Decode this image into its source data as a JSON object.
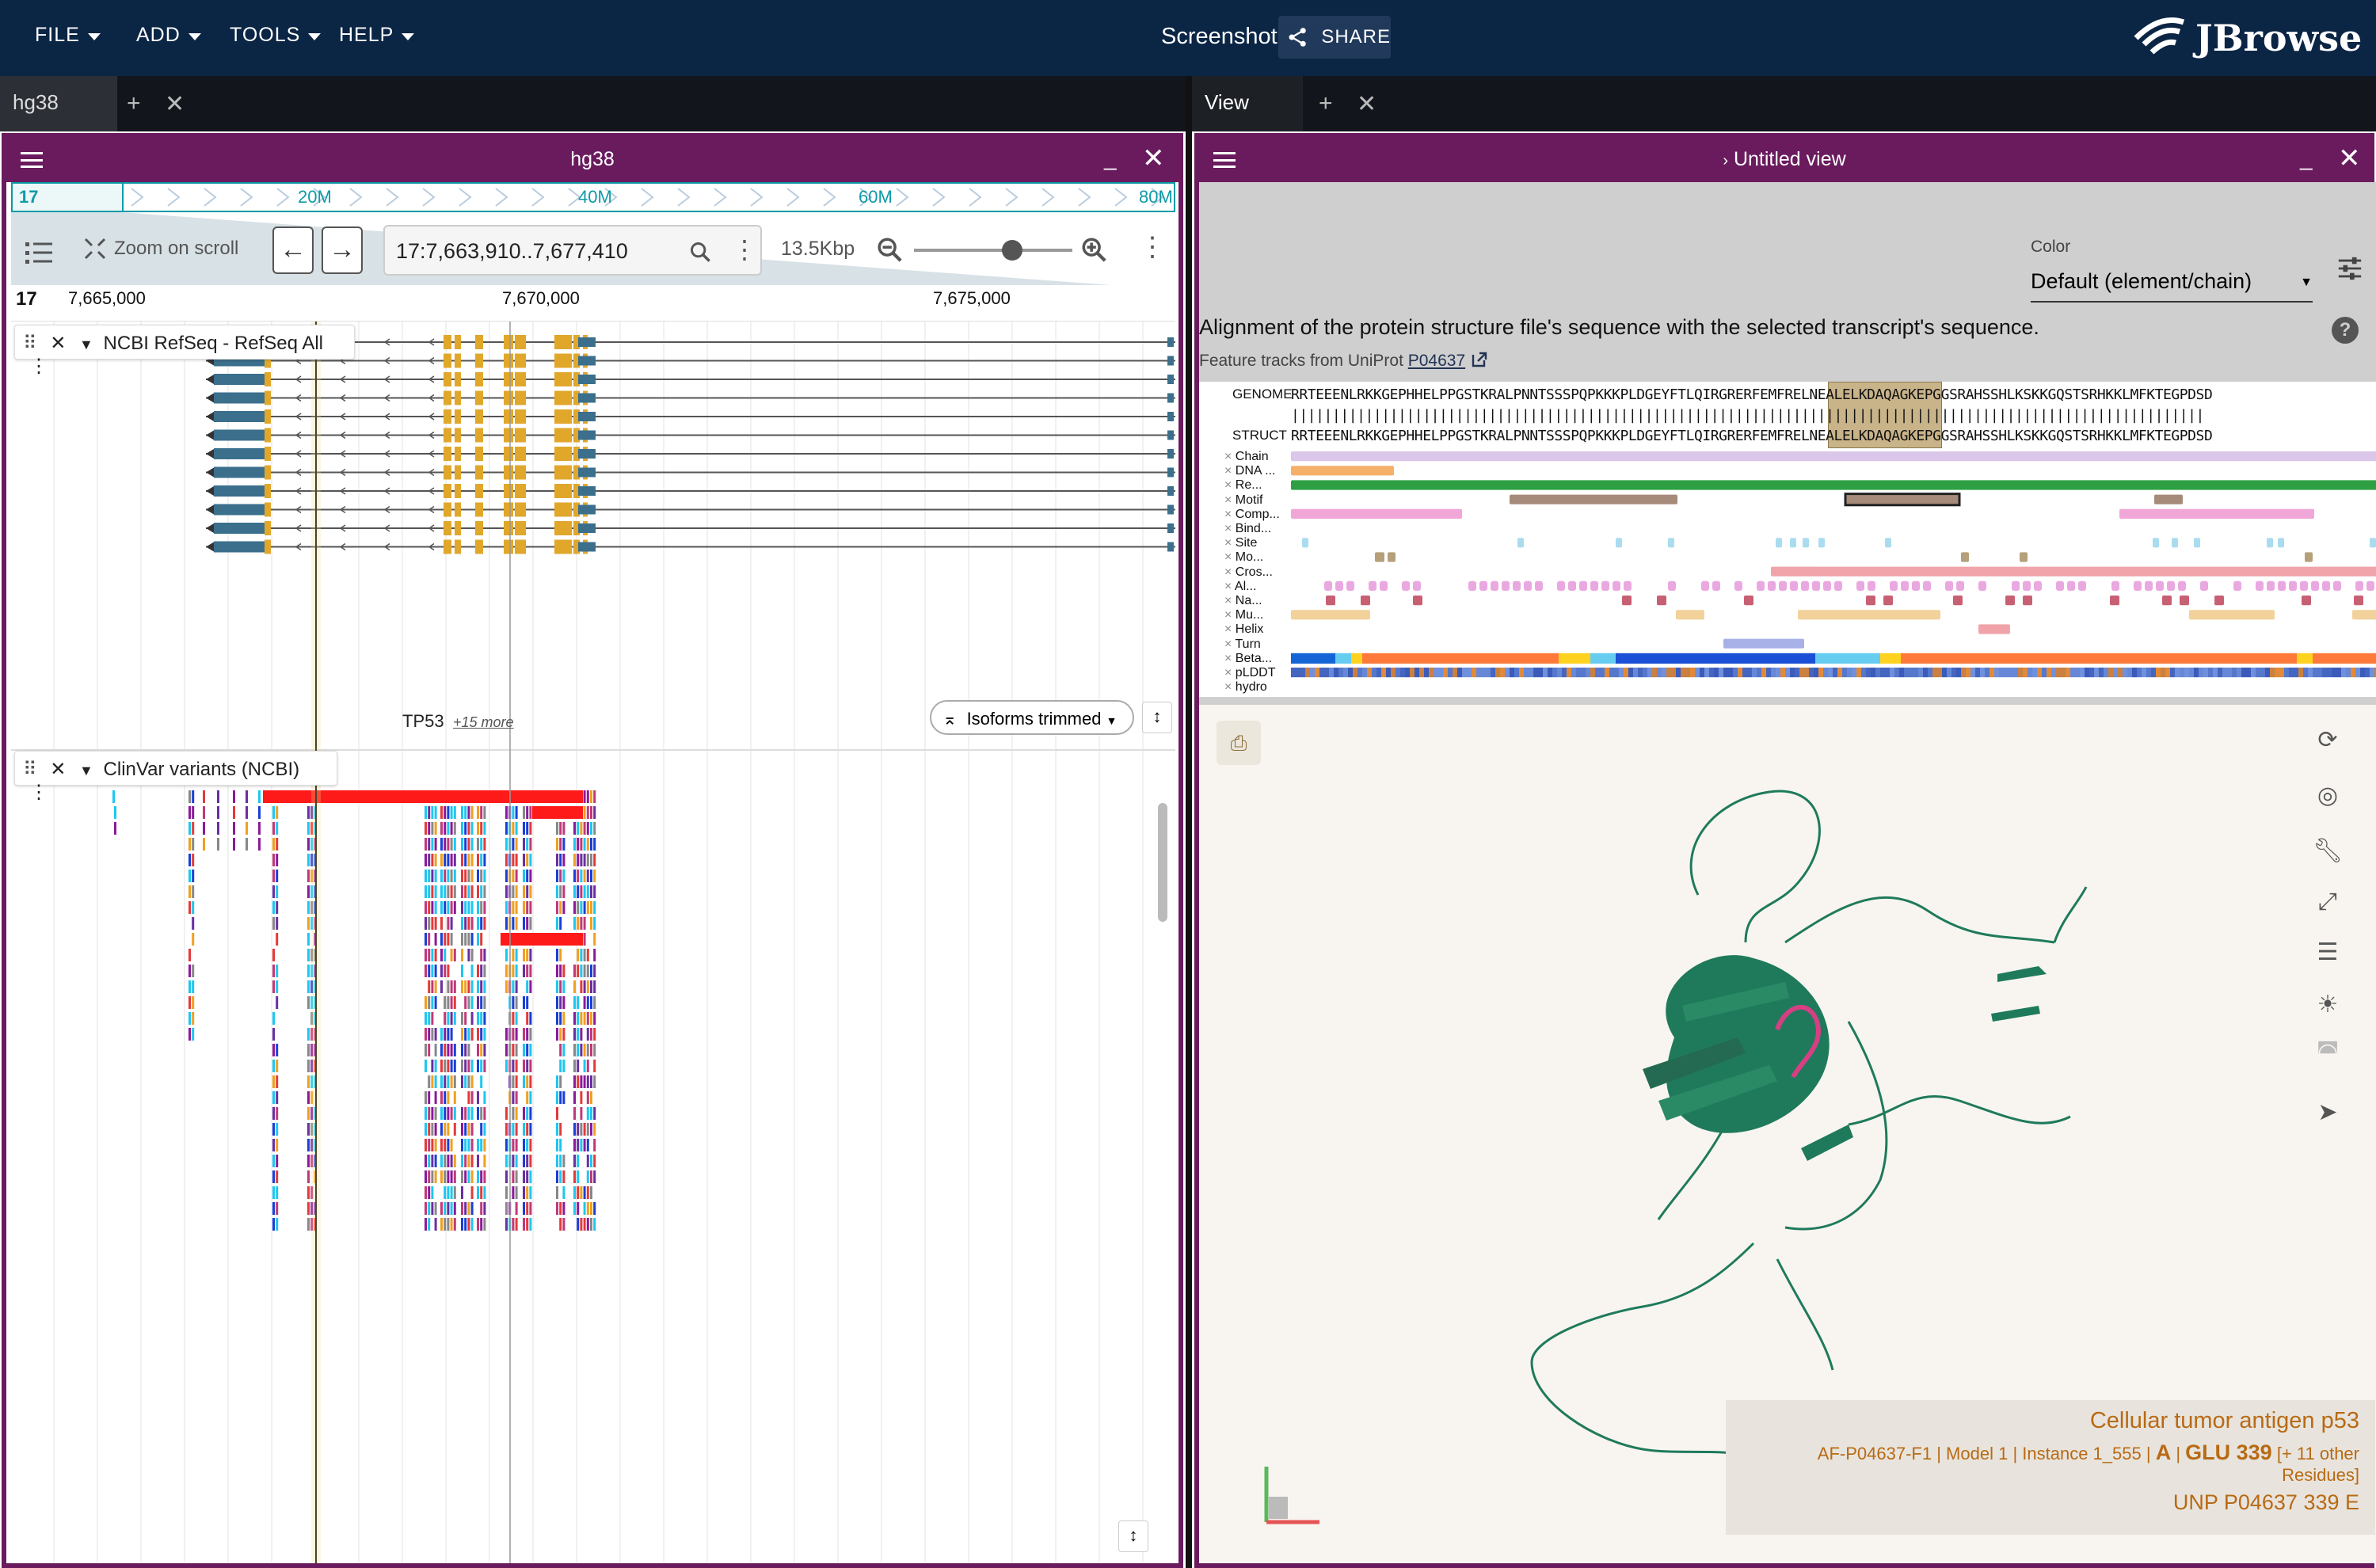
{
  "menubar": {
    "items": [
      {
        "label": "FILE"
      },
      {
        "label": "ADD"
      },
      {
        "label": "TOOLS"
      },
      {
        "label": "HELP"
      }
    ],
    "session_title": "Screenshot",
    "share_label": "SHARE",
    "logo_text": "JBrowse"
  },
  "tabs": {
    "left": {
      "label": "hg38"
    },
    "right": {
      "label": "View"
    }
  },
  "left_view": {
    "title": "hg38",
    "overview": {
      "chrom": "17",
      "ticks": [
        "20M",
        "40M",
        "60M",
        "80M"
      ]
    },
    "zoom_on_scroll": "Zoom on scroll",
    "locstring": "17:7,663,910..7,677,410",
    "span": "13.5Kbp",
    "zoom_level": 0.62,
    "ruler": {
      "chrom": "17",
      "ticks": [
        "7,665,000",
        "7,670,000",
        "7,675,000"
      ]
    },
    "tracks": {
      "refseq": {
        "name": "NCBI RefSeq - RefSeq All",
        "gene_label": "TP53",
        "more_label": "+15 more",
        "isoform_button": "Isoforms trimmed"
      },
      "clinvar": {
        "name": "ClinVar variants (NCBI)"
      }
    }
  },
  "right_view": {
    "title": "Untitled view",
    "color_label": "Color",
    "color_value": "Default (element/chain)",
    "alignment_text": "Alignment of the protein structure file's sequence with the selected transcript's sequence.",
    "feature_prefix": "Feature tracks from UniProt",
    "uniprot_id": "P04637",
    "genome_label": "GENOME",
    "struct_label": "STRUCT",
    "genome_seq": "RRTEEENLRKKGEPHHELPPGSTKRALPNNTSSSPQPKKKPLDGEYFTLQIRGRERFEMFRELNEALELKDAQAGKEPGGSRAHSSHLKSKKGQSTSRHKKLMFKTEGPDSD",
    "match_line": "|||||||||||||||||||||||||||||||||||||||||||||||||||||||||||||||||||||||||||||||||||||||||||||||||||||||||||||||",
    "struct_seq": "RRTEEENLRKKGEPHHELPPGSTKRALPNNTSSSPQPKKKPLDGEYFTLQIRGRERFEMFRELNEALELKDAQAGKEPGGSRAHSSHLKSKKGQSTSRHKKLMFKTEGPDSD",
    "feature_rows": [
      "Chain",
      "DNA ...",
      "Re...",
      "Motif",
      "Comp...",
      "Bind...",
      "Site",
      "Mo...",
      "Cros...",
      "Al...",
      "Na...",
      "Mu...",
      "Helix",
      "Turn",
      "Beta...",
      "pLDDT",
      "hydro"
    ],
    "info": {
      "protein": "Cellular tumor antigen p53",
      "model": "AF-P04637-F1",
      "model_num": "Model 1",
      "instance": "Instance 1_555",
      "chain": "A",
      "residue": "GLU 339",
      "extra": "[+ 11 other",
      "extra2": "Residues]",
      "unp": "UNP P04637 339 E"
    }
  },
  "colors": {
    "menubar": "#0b2545",
    "panel_border": "#6a1b5e",
    "refseq_utr": "#3b6f8c",
    "refseq_cds": "#e0a72b",
    "protein": "#1f7a5c",
    "highlight": "#d63f84"
  },
  "icons": [
    "menu-icon",
    "share-icon",
    "close-icon",
    "minimize-icon",
    "search-icon",
    "zoom-in-icon",
    "zoom-out-icon",
    "arrow-left-icon",
    "arrow-right-icon",
    "drag-handle-icon",
    "chevron-down-icon",
    "help-icon",
    "settings-icon",
    "external-link-icon",
    "reset-icon",
    "camera-icon",
    "wrench-icon",
    "expand-icon",
    "sliders-icon",
    "light-icon",
    "vr-icon",
    "cursor-icon",
    "screenshot-icon"
  ]
}
